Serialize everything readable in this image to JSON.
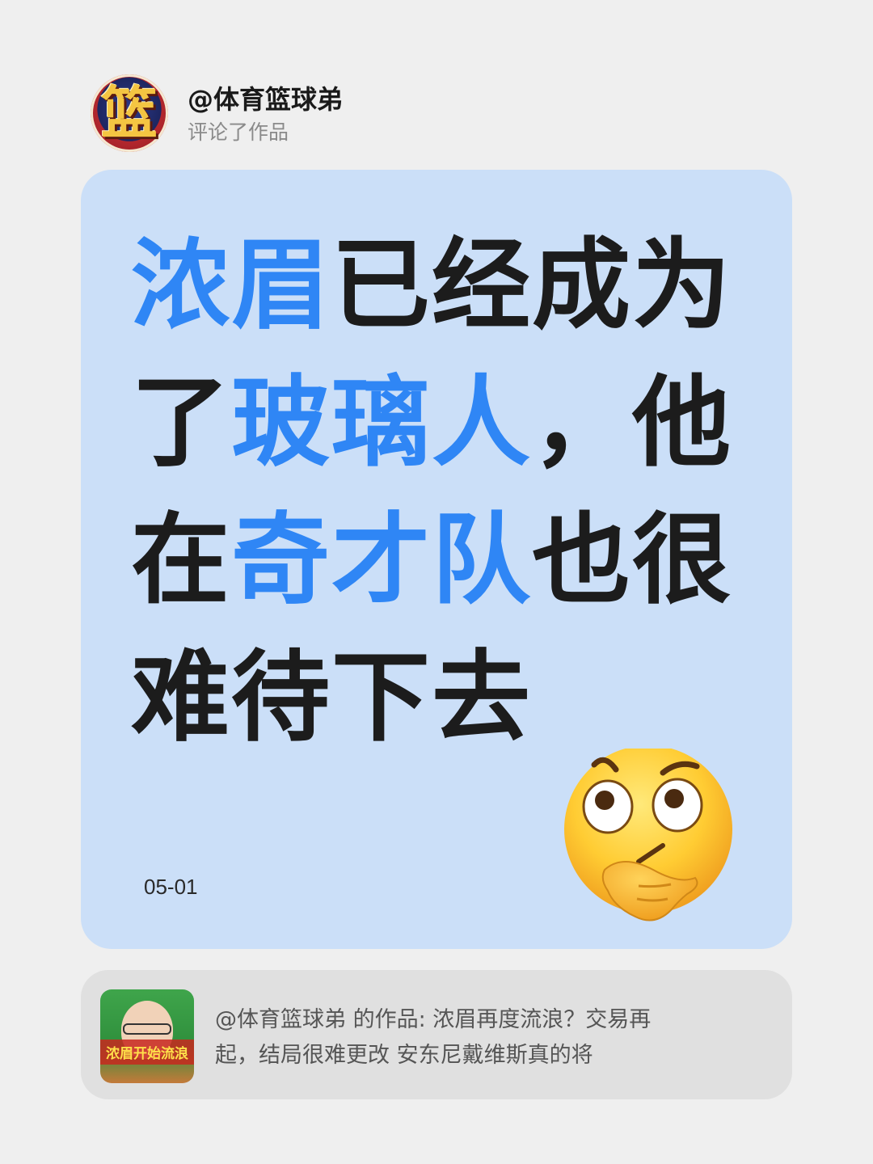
{
  "header": {
    "username": "@体育篮球弟",
    "action_text": "评论了作品",
    "avatar_glyph": "篮"
  },
  "card": {
    "headline_lines": [
      [
        {
          "text": "浓眉",
          "highlight": true
        },
        {
          "text": "已经成为",
          "highlight": false
        }
      ],
      [
        {
          "text": "了",
          "highlight": false
        },
        {
          "text": "玻璃人",
          "highlight": true
        },
        {
          "text": "，他",
          "highlight": false
        }
      ],
      [
        {
          "text": "在",
          "highlight": false
        },
        {
          "text": "奇才队",
          "highlight": true
        },
        {
          "text": "也很",
          "highlight": false
        }
      ],
      [
        {
          "text": "难待下去",
          "highlight": false
        }
      ]
    ],
    "date": "05-01",
    "emoji": "thinking-face-icon",
    "colors": {
      "card_bg": "#cbdff8",
      "highlight": "#2f86f5",
      "text": "#1c1c1c"
    }
  },
  "reference": {
    "thumbnail_caption": "浓眉开始流浪",
    "text_line_1": "@体育篮球弟  的作品: 浓眉再度流浪？交易再",
    "text_line_2": "起，结局很难更改 安东尼戴维斯真的将"
  }
}
